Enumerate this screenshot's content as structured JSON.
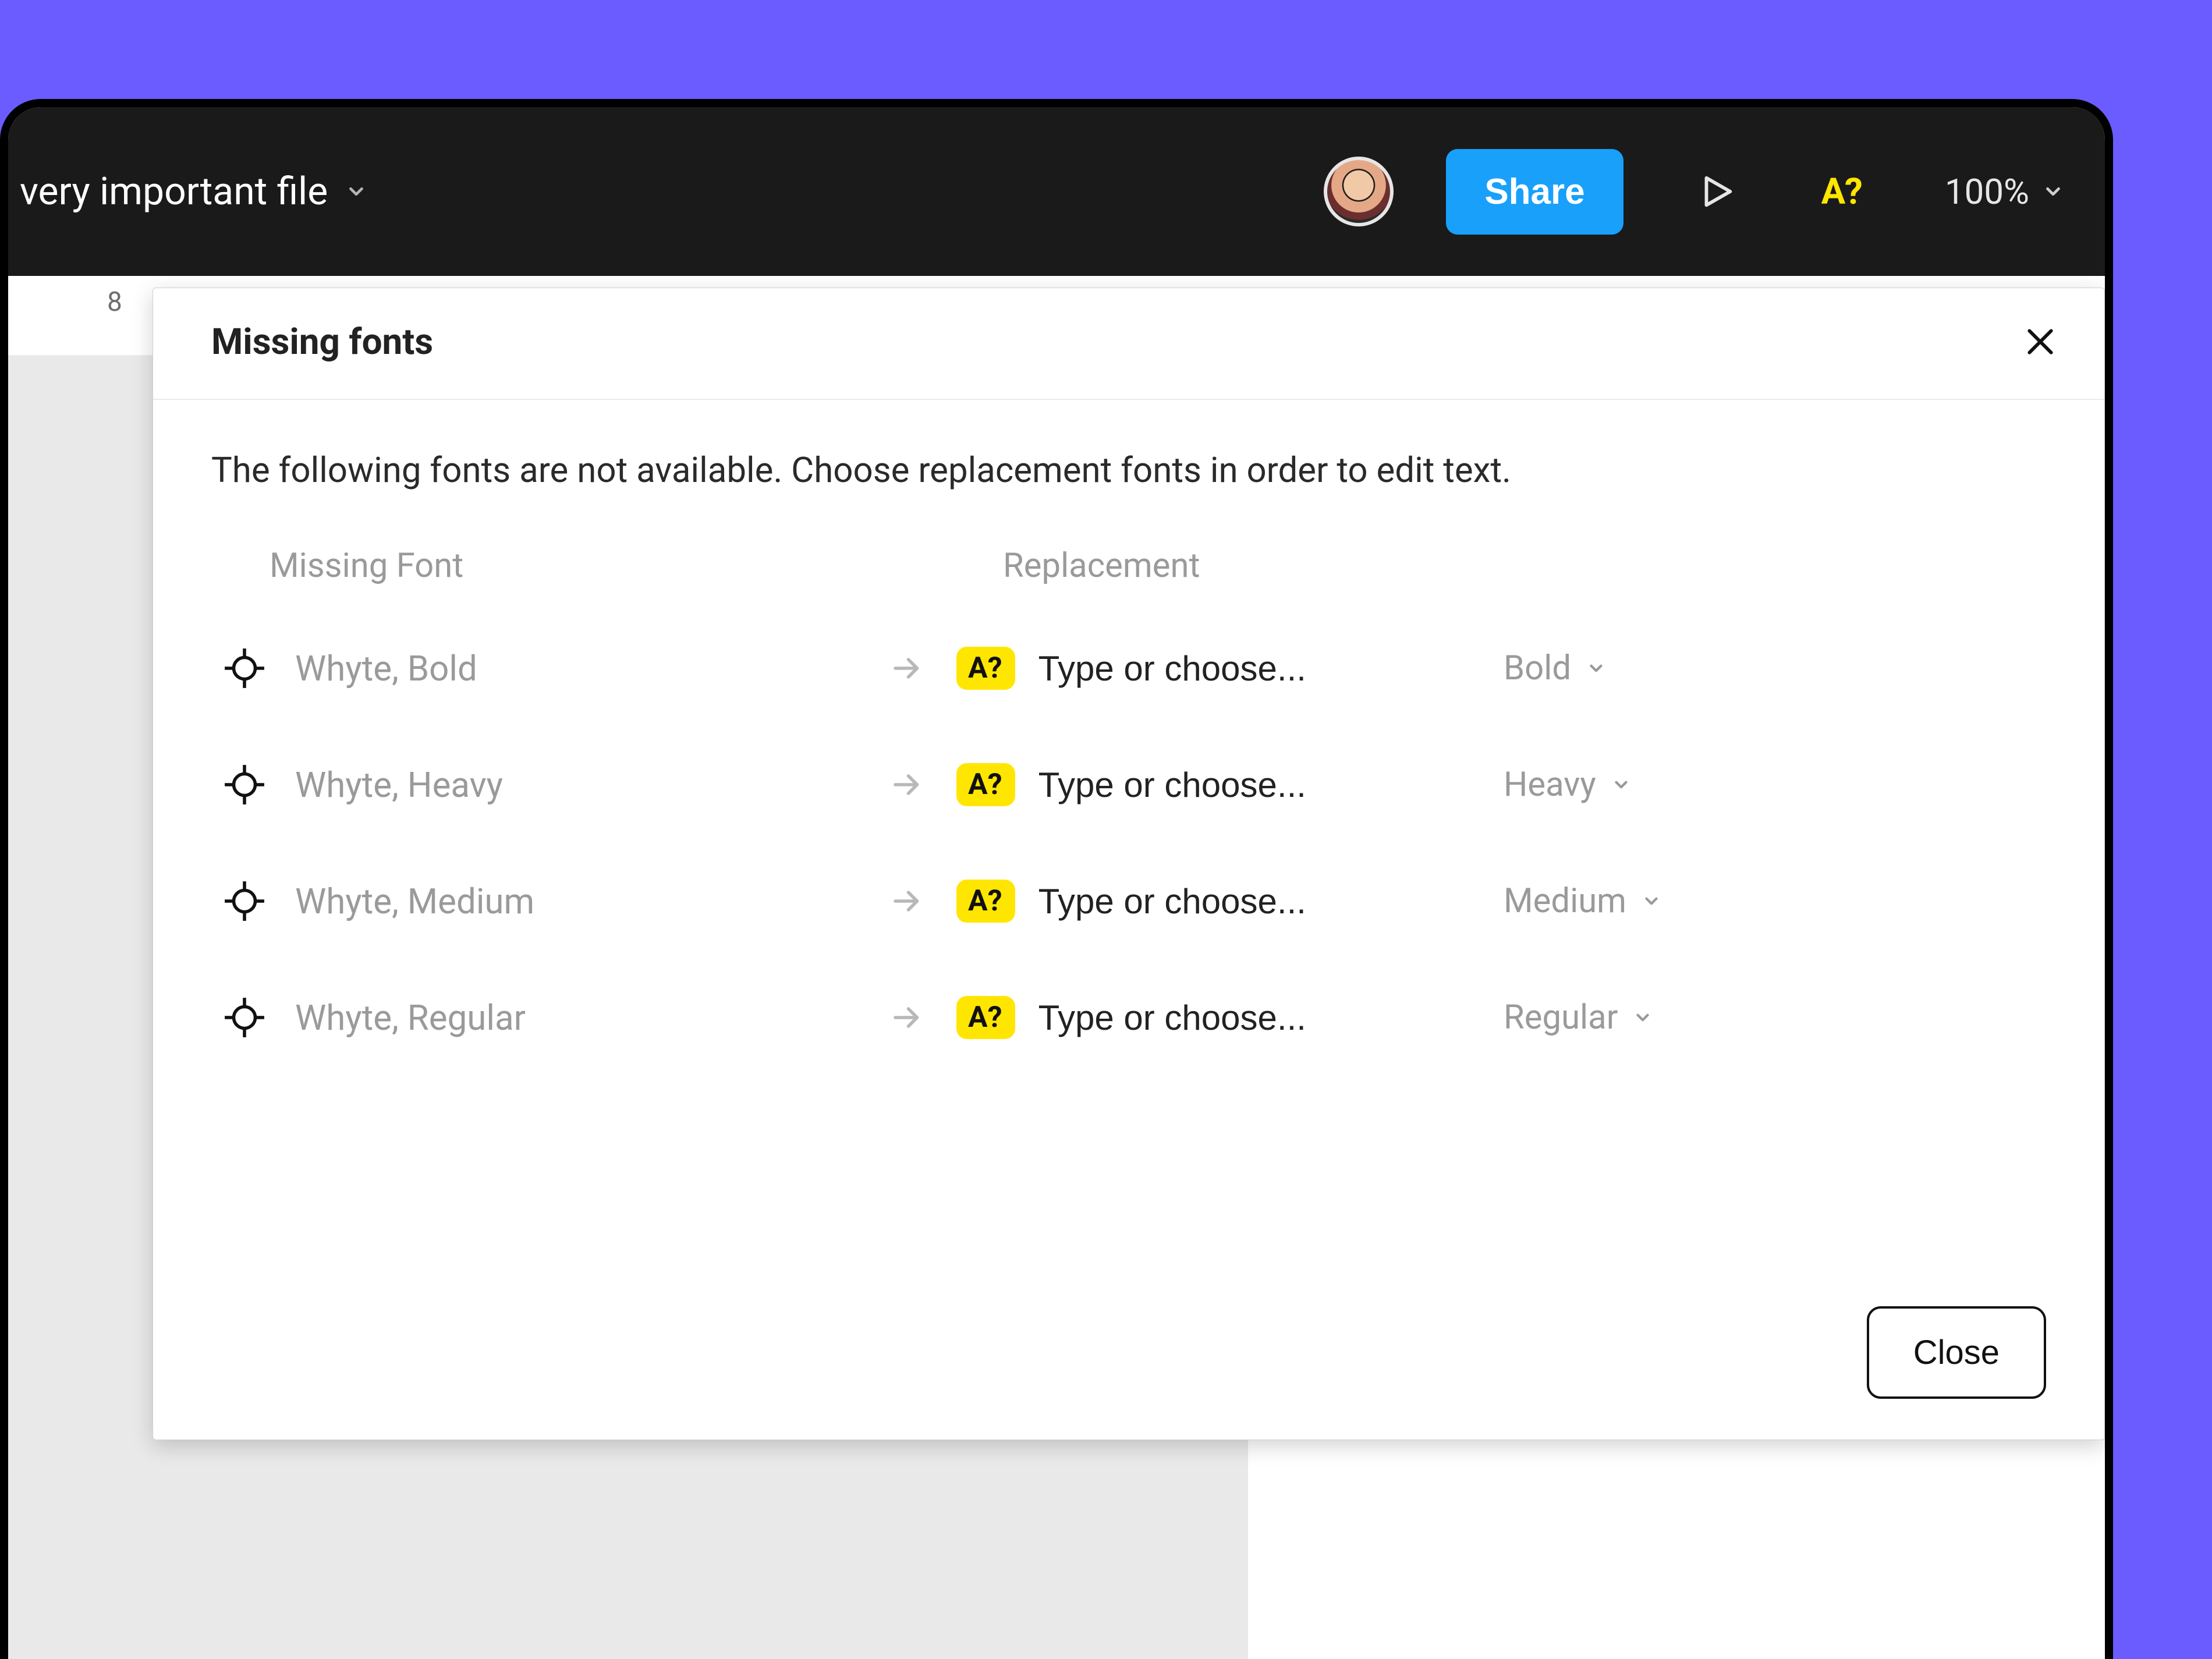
{
  "header": {
    "file_title": "very important file",
    "share_label": "Share",
    "missing_indicator": "A?",
    "zoom_label": "100%"
  },
  "ruler": {
    "visible_tick": "8"
  },
  "modal": {
    "title": "Missing fonts",
    "description": "The following fonts are not available. Choose replacement fonts in order to edit text.",
    "col_missing": "Missing Font",
    "col_replacement": "Replacement",
    "badge_text": "A?",
    "replacement_placeholder": "Type or choose...",
    "close_label": "Close",
    "rows": [
      {
        "missing": "Whyte, Bold",
        "style": "Bold"
      },
      {
        "missing": "Whyte, Heavy",
        "style": "Heavy"
      },
      {
        "missing": "Whyte, Medium",
        "style": "Medium"
      },
      {
        "missing": "Whyte, Regular",
        "style": "Regular"
      }
    ]
  },
  "colors": {
    "background": "#6a5cff",
    "accent": "#18a0fb",
    "warning_badge": "#ffe600"
  }
}
